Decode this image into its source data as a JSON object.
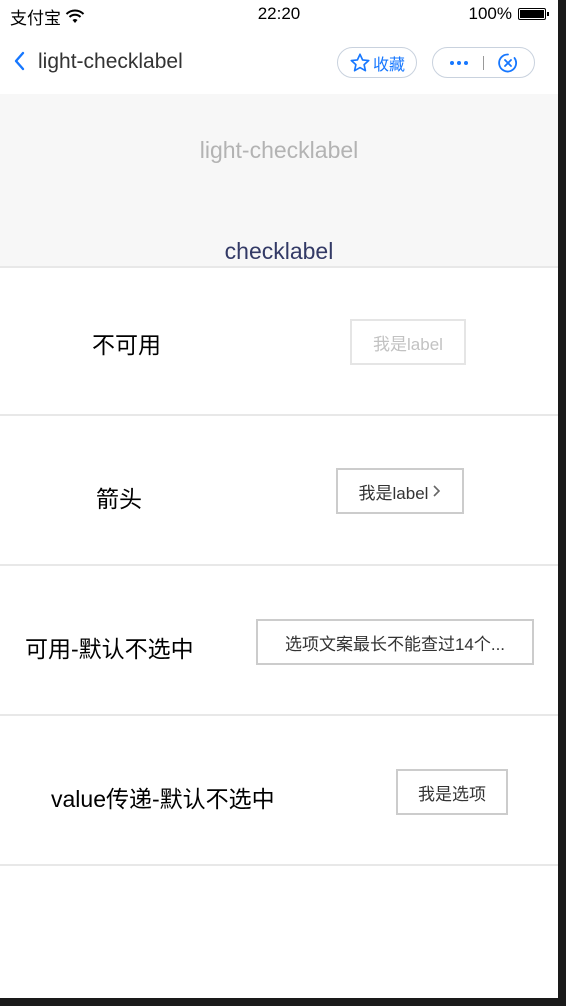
{
  "status_bar": {
    "carrier": "支付宝",
    "time": "22:20",
    "battery": "100%"
  },
  "nav": {
    "title": "light-checklabel",
    "fav_label": "收藏"
  },
  "header": {
    "title": "light-checklabel",
    "subtitle": "checklabel"
  },
  "sections": [
    {
      "label": "不可用",
      "checklabel": "我是label",
      "state": "disabled"
    },
    {
      "label": "箭头",
      "checklabel": "我是label",
      "state": "arrow"
    },
    {
      "label": "可用-默认不选中",
      "checklabel": "选项文案最长不能查过14个...",
      "state": "normal"
    },
    {
      "label": "value传递-默认不选中",
      "checklabel": "我是选项",
      "state": "normal"
    }
  ],
  "colors": {
    "accent": "#1677ff",
    "header_bg": "#f7f7f7",
    "subtitle": "#333a66",
    "border": "#cccccc"
  },
  "icons": [
    "wifi-icon",
    "battery-icon",
    "back-chevron-icon",
    "star-icon",
    "more-icon",
    "close-circle-icon",
    "chevron-right-icon"
  ]
}
